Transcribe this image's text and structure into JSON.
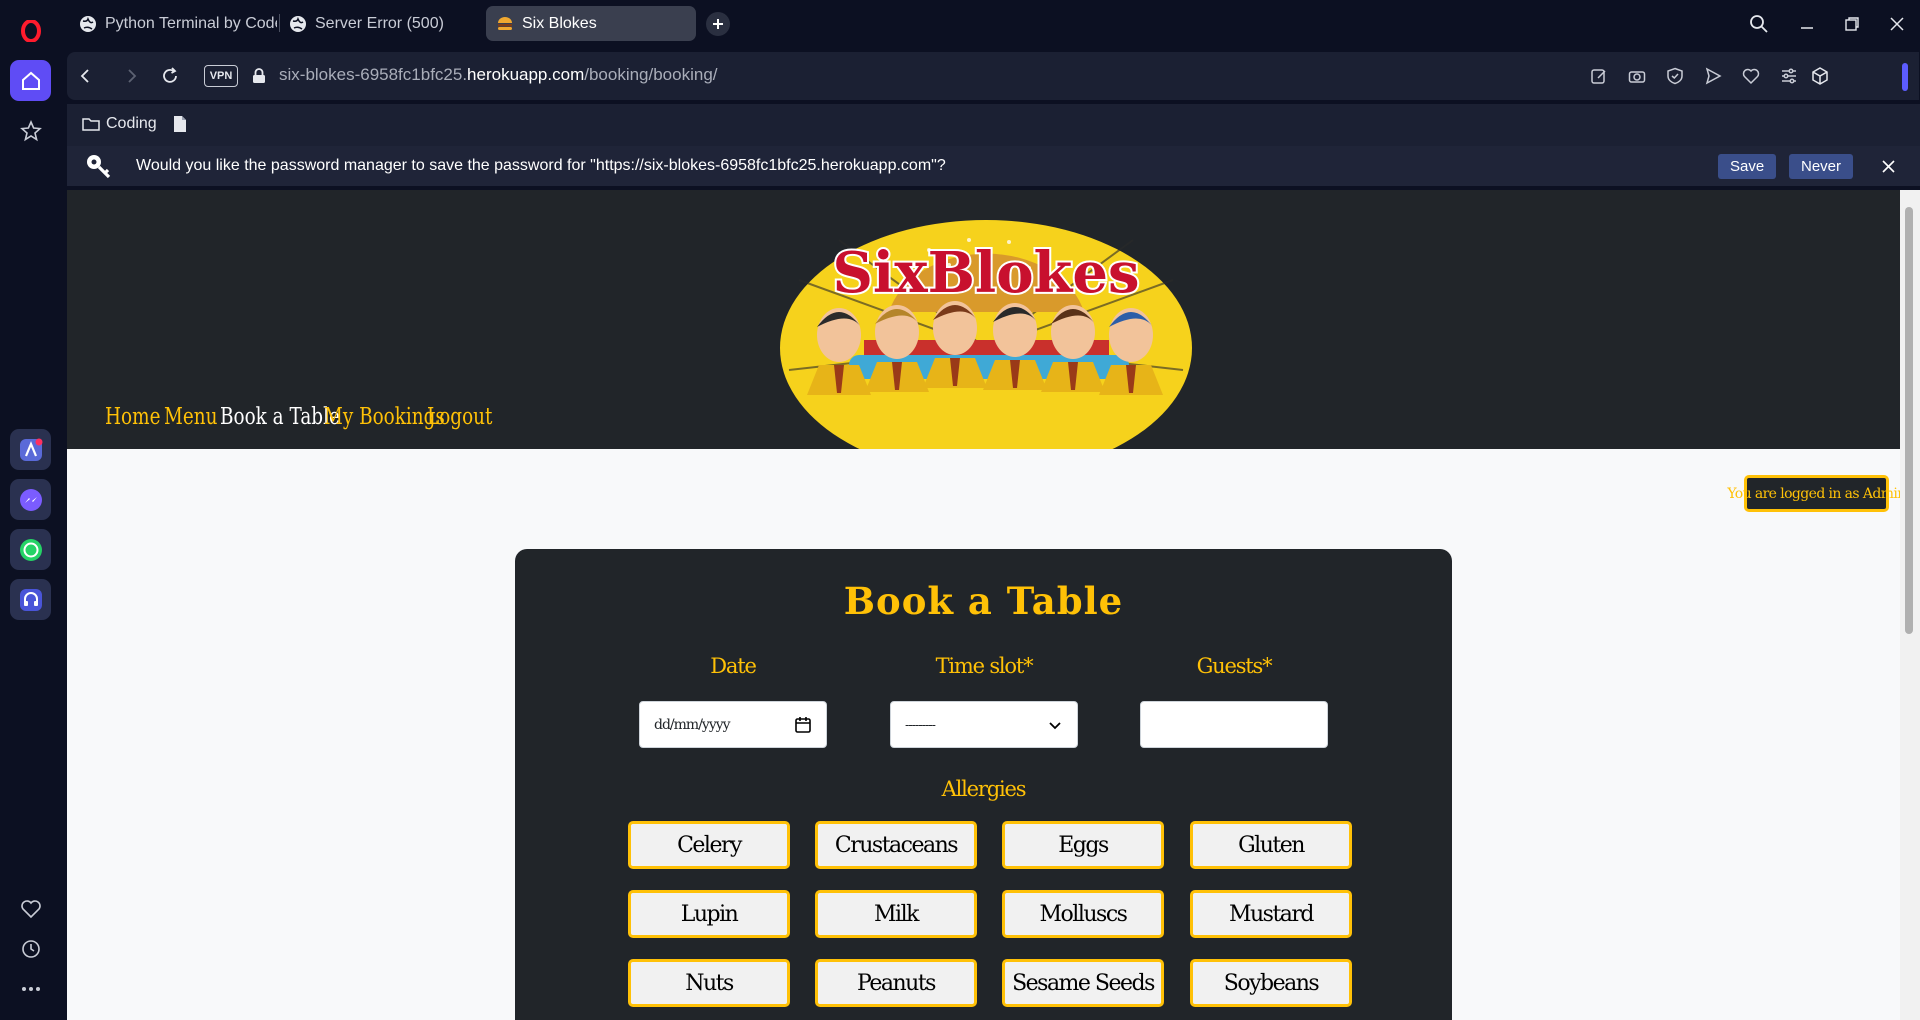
{
  "browser": {
    "tabs": [
      {
        "label": "Python Terminal by Code"
      },
      {
        "label": "Server Error (500)"
      },
      {
        "label": "Six Blokes"
      }
    ],
    "address": {
      "vpn_label": "VPN",
      "url_prefix": "six-blokes-6958fc1bfc25.",
      "url_host": "herokuapp.com",
      "url_path": "/booking/booking/"
    },
    "bookmarks": [
      {
        "label": "Coding"
      }
    ],
    "password_prompt": {
      "message": "Would you like the password manager to save the password for \"https://six-blokes-6958fc1bfc25.herokuapp.com\"?",
      "save_label": "Save",
      "never_label": "Never"
    }
  },
  "site": {
    "logo_text": "SixBlokes",
    "nav": [
      {
        "label": "Home"
      },
      {
        "label": "Menu"
      },
      {
        "label": "Book a Table"
      },
      {
        "label": "My Bookings"
      },
      {
        "label": "Logout"
      }
    ],
    "login_badge": "You are logged in as Admin",
    "booking": {
      "title": "Book a Table",
      "date_label": "Date",
      "date_placeholder": "dd/mm/yyyy",
      "timeslot_label": "Time slot*",
      "timeslot_value": "---------",
      "guests_label": "Guests*",
      "guests_value": "",
      "allergies_label": "Allergies",
      "allergies": [
        "Celery",
        "Crustaceans",
        "Eggs",
        "Gluten",
        "Lupin",
        "Milk",
        "Molluscs",
        "Mustard",
        "Nuts",
        "Peanuts",
        "Sesame Seeds",
        "Soybeans"
      ]
    }
  },
  "colors": {
    "accent": "#ffc107",
    "dark": "#212529",
    "browser_bg": "#0c1022"
  }
}
